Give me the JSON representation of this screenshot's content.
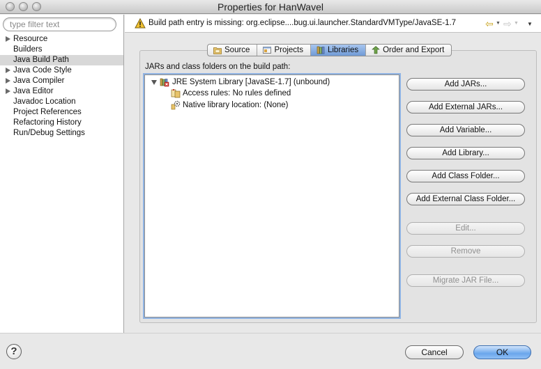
{
  "window": {
    "title": "Properties for HanWavel"
  },
  "filter": {
    "placeholder": "type filter text",
    "value": ""
  },
  "sidebar": {
    "items": [
      {
        "label": "Resource",
        "expandable": true,
        "selected": false
      },
      {
        "label": "Builders",
        "expandable": false,
        "selected": false
      },
      {
        "label": "Java Build Path",
        "expandable": false,
        "selected": true
      },
      {
        "label": "Java Code Style",
        "expandable": true,
        "selected": false
      },
      {
        "label": "Java Compiler",
        "expandable": true,
        "selected": false
      },
      {
        "label": "Java Editor",
        "expandable": true,
        "selected": false
      },
      {
        "label": "Javadoc Location",
        "expandable": false,
        "selected": false
      },
      {
        "label": "Project References",
        "expandable": false,
        "selected": false
      },
      {
        "label": "Refactoring History",
        "expandable": false,
        "selected": false
      },
      {
        "label": "Run/Debug Settings",
        "expandable": false,
        "selected": false
      }
    ]
  },
  "message": {
    "icon": "warning-icon",
    "text": "Build path entry is missing: org.eclipse....bug.ui.launcher.StandardVMType/JavaSE-1.7"
  },
  "tabs": [
    {
      "label": "Source",
      "icon": "source-folder-icon",
      "active": false
    },
    {
      "label": "Projects",
      "icon": "projects-icon",
      "active": false
    },
    {
      "label": "Libraries",
      "icon": "libraries-icon",
      "active": true
    },
    {
      "label": "Order and Export",
      "icon": "order-export-icon",
      "active": false
    }
  ],
  "libraries": {
    "section_label": "JARs and class folders on the build path:",
    "root": {
      "label": "JRE System Library [JavaSE-1.7] (unbound)",
      "icon": "jre-library-icon",
      "expanded": true
    },
    "children": [
      {
        "label": "Access rules: No rules defined",
        "icon": "access-rules-icon"
      },
      {
        "label": "Native library location: (None)",
        "icon": "native-library-icon"
      }
    ]
  },
  "buttons": {
    "add_jars": "Add JARs...",
    "add_external_jars": "Add External JARs...",
    "add_variable": "Add Variable...",
    "add_library": "Add Library...",
    "add_class_folder": "Add Class Folder...",
    "add_external_class_folder": "Add External Class Folder...",
    "edit": "Edit...",
    "remove": "Remove",
    "migrate_jar": "Migrate JAR File..."
  },
  "footer": {
    "help": "?",
    "cancel": "Cancel",
    "ok": "OK"
  },
  "colors": {
    "accent": "#6f9ad6",
    "default_button": "#6aa6ec",
    "warning": "#f1c232"
  }
}
